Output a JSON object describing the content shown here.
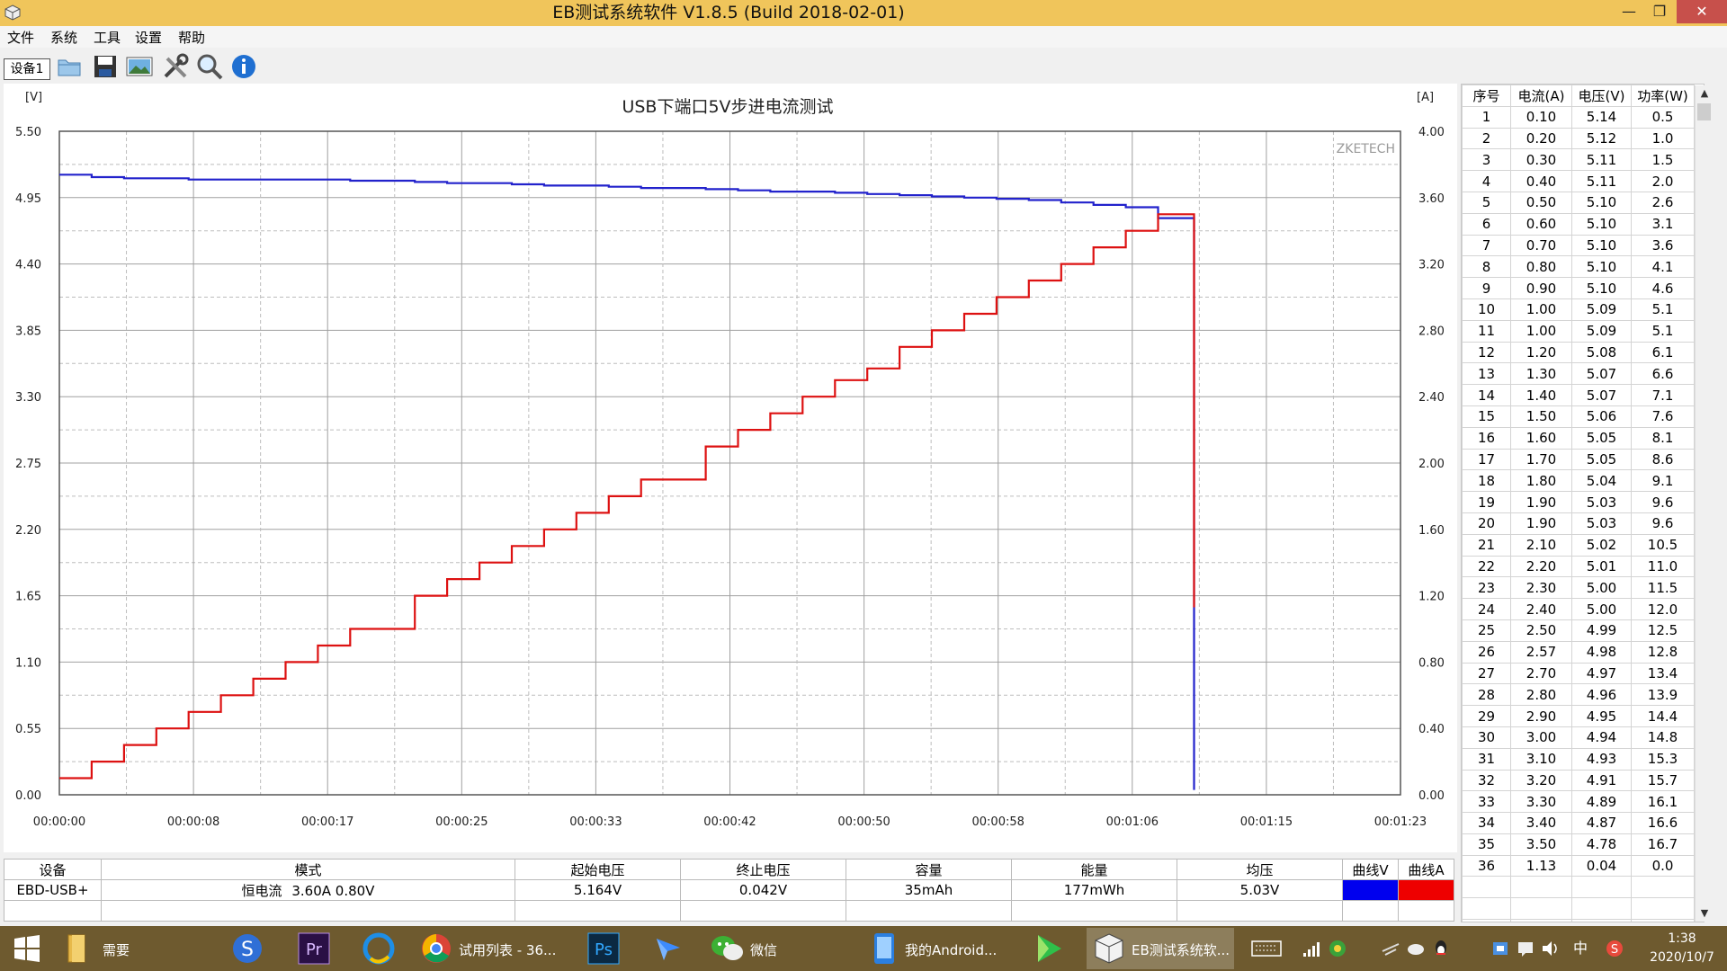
{
  "window": {
    "title": "EB测试系统软件 V1.8.5 (Build 2018-02-01)",
    "minimize_glyph": "—",
    "maximize_glyph": "❐",
    "close_glyph": "✕"
  },
  "menu": [
    "文件",
    "系统",
    "工具",
    "设置",
    "帮助"
  ],
  "toolbar": {
    "device_tab": "设备1",
    "tools": [
      "open-folder-icon",
      "save-icon",
      "image-icon",
      "tools-icon",
      "search-icon",
      "info-icon"
    ]
  },
  "chart_data": {
    "type": "line",
    "title": "USB下端口5V步进电流测试",
    "watermark": "ZKETECH",
    "left_unit": "[V]",
    "right_unit": "[A]",
    "ylim_left": [
      0,
      5.5
    ],
    "ylim_right": [
      0,
      4
    ],
    "left_ticks": [
      "0.00",
      "0.55",
      "1.10",
      "1.65",
      "2.20",
      "2.75",
      "3.30",
      "3.85",
      "4.40",
      "4.95",
      "5.50"
    ],
    "right_ticks": [
      "0.00",
      "0.40",
      "0.80",
      "1.20",
      "1.60",
      "2.00",
      "2.40",
      "2.80",
      "3.20",
      "3.60",
      "4.00"
    ],
    "x_tick_labels": [
      "00:00:00",
      "00:00:08",
      "00:00:17",
      "00:00:25",
      "00:00:33",
      "00:00:42",
      "00:00:50",
      "00:00:58",
      "00:01:06",
      "00:01:15",
      "00:01:23"
    ],
    "grid": true,
    "step_seconds": 2,
    "series": [
      {
        "axis": "left",
        "color": "#2222cc",
        "values": [
          5.14,
          5.12,
          5.11,
          5.11,
          5.1,
          5.1,
          5.1,
          5.1,
          5.1,
          5.09,
          5.09,
          5.08,
          5.07,
          5.07,
          5.06,
          5.05,
          5.05,
          5.04,
          5.03,
          5.03,
          5.02,
          5.01,
          5.0,
          5.0,
          4.99,
          4.98,
          4.97,
          4.96,
          4.95,
          4.94,
          4.93,
          4.91,
          4.89,
          4.87,
          4.78,
          0.04
        ]
      },
      {
        "axis": "right",
        "color": "#dd1111",
        "values": [
          0.1,
          0.2,
          0.3,
          0.4,
          0.5,
          0.6,
          0.7,
          0.8,
          0.9,
          1.0,
          1.0,
          1.2,
          1.3,
          1.4,
          1.5,
          1.6,
          1.7,
          1.8,
          1.9,
          1.9,
          2.1,
          2.2,
          2.3,
          2.4,
          2.5,
          2.57,
          2.7,
          2.8,
          2.9,
          3.0,
          3.1,
          3.2,
          3.3,
          3.4,
          3.5,
          1.13
        ]
      }
    ]
  },
  "records": {
    "headers": [
      "序号",
      "电流(A)",
      "电压(V)",
      "功率(W)"
    ],
    "rows": [
      [
        "1",
        "0.10",
        "5.14",
        "0.5"
      ],
      [
        "2",
        "0.20",
        "5.12",
        "1.0"
      ],
      [
        "3",
        "0.30",
        "5.11",
        "1.5"
      ],
      [
        "4",
        "0.40",
        "5.11",
        "2.0"
      ],
      [
        "5",
        "0.50",
        "5.10",
        "2.6"
      ],
      [
        "6",
        "0.60",
        "5.10",
        "3.1"
      ],
      [
        "7",
        "0.70",
        "5.10",
        "3.6"
      ],
      [
        "8",
        "0.80",
        "5.10",
        "4.1"
      ],
      [
        "9",
        "0.90",
        "5.10",
        "4.6"
      ],
      [
        "10",
        "1.00",
        "5.09",
        "5.1"
      ],
      [
        "11",
        "1.00",
        "5.09",
        "5.1"
      ],
      [
        "12",
        "1.20",
        "5.08",
        "6.1"
      ],
      [
        "13",
        "1.30",
        "5.07",
        "6.6"
      ],
      [
        "14",
        "1.40",
        "5.07",
        "7.1"
      ],
      [
        "15",
        "1.50",
        "5.06",
        "7.6"
      ],
      [
        "16",
        "1.60",
        "5.05",
        "8.1"
      ],
      [
        "17",
        "1.70",
        "5.05",
        "8.6"
      ],
      [
        "18",
        "1.80",
        "5.04",
        "9.1"
      ],
      [
        "19",
        "1.90",
        "5.03",
        "9.6"
      ],
      [
        "20",
        "1.90",
        "5.03",
        "9.6"
      ],
      [
        "21",
        "2.10",
        "5.02",
        "10.5"
      ],
      [
        "22",
        "2.20",
        "5.01",
        "11.0"
      ],
      [
        "23",
        "2.30",
        "5.00",
        "11.5"
      ],
      [
        "24",
        "2.40",
        "5.00",
        "12.0"
      ],
      [
        "25",
        "2.50",
        "4.99",
        "12.5"
      ],
      [
        "26",
        "2.57",
        "4.98",
        "12.8"
      ],
      [
        "27",
        "2.70",
        "4.97",
        "13.4"
      ],
      [
        "28",
        "2.80",
        "4.96",
        "13.9"
      ],
      [
        "29",
        "2.90",
        "4.95",
        "14.4"
      ],
      [
        "30",
        "3.00",
        "4.94",
        "14.8"
      ],
      [
        "31",
        "3.10",
        "4.93",
        "15.3"
      ],
      [
        "32",
        "3.20",
        "4.91",
        "15.7"
      ],
      [
        "33",
        "3.30",
        "4.89",
        "16.1"
      ],
      [
        "34",
        "3.40",
        "4.87",
        "16.6"
      ],
      [
        "35",
        "3.50",
        "4.78",
        "16.7"
      ],
      [
        "36",
        "1.13",
        "0.04",
        "0.0"
      ]
    ]
  },
  "summary": {
    "headers": [
      "设备",
      "模式",
      "起始电压",
      "终止电压",
      "容量",
      "能量",
      "均压",
      "曲线V",
      "曲线A"
    ],
    "device": "EBD-USB+",
    "mode_label": "恒电流",
    "mode_value": "3.60A  0.80V",
    "start_voltage": "5.164V",
    "end_voltage": "0.042V",
    "capacity": "35mAh",
    "energy": "177mWh",
    "avg_voltage": "5.03V",
    "curve_v_color": "#0000ee",
    "curve_a_color": "#ee0000"
  },
  "taskbar": {
    "start_icon": "windows-start-icon",
    "items": [
      {
        "icon": "folder-icon",
        "label": "需要"
      },
      {
        "icon": "sogou-icon",
        "label": ""
      },
      {
        "icon": "premiere-icon",
        "label": ""
      },
      {
        "icon": "browser-icon",
        "label": ""
      },
      {
        "icon": "chrome-icon",
        "label": "试用列表 - 36..."
      },
      {
        "icon": "photoshop-icon",
        "label": ""
      },
      {
        "icon": "feishu-icon",
        "label": ""
      },
      {
        "icon": "wechat-icon",
        "label": "微信"
      },
      {
        "icon": "phone-icon",
        "label": "我的Android..."
      },
      {
        "icon": "play-icon",
        "label": ""
      },
      {
        "icon": "eb-app-icon",
        "label": "EB测试系统软..."
      }
    ],
    "tray": {
      "ime": "中"
    },
    "clock": {
      "time": "1:38",
      "date": "2020/10/7"
    }
  }
}
